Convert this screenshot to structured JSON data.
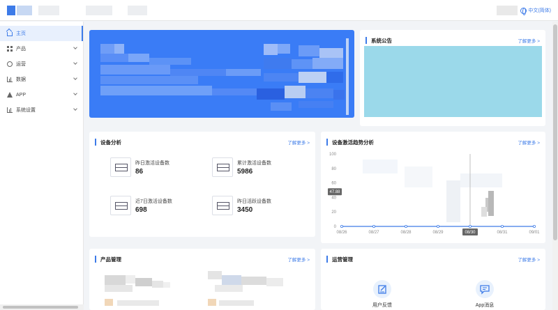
{
  "header": {
    "lang_label": "中文(简体)"
  },
  "sidebar": {
    "items": [
      {
        "label": "主页",
        "icon": "home-icon",
        "active": true,
        "has_children": false
      },
      {
        "label": "产品",
        "icon": "grid-icon",
        "active": false,
        "has_children": true
      },
      {
        "label": "运营",
        "icon": "globe-icon",
        "active": false,
        "has_children": true
      },
      {
        "label": "数据",
        "icon": "bar-chart-icon",
        "active": false,
        "has_children": true
      },
      {
        "label": "APP",
        "icon": "warning-icon",
        "active": false,
        "has_children": true
      },
      {
        "label": "系统设置",
        "icon": "bar-chart-icon",
        "active": false,
        "has_children": true
      }
    ]
  },
  "notice": {
    "title": "系统公告",
    "more": "了解更多 >"
  },
  "device_analysis": {
    "title": "设备分析",
    "more": "了解更多 >",
    "stats": [
      {
        "label": "昨日激活设备数",
        "value": "86"
      },
      {
        "label": "累计激活设备数",
        "value": "5986"
      },
      {
        "label": "近7日激活设备数",
        "value": "698"
      },
      {
        "label": "昨日活跃设备数",
        "value": "3450"
      }
    ]
  },
  "trend": {
    "title": "设备激活趋势分析",
    "more": "了解更多 >",
    "tooltip_value": "47.88",
    "highlight_date": "08/30"
  },
  "product_mgmt": {
    "title": "产品管理",
    "more": "了解更多 >"
  },
  "ops_mgmt": {
    "title": "运营管理",
    "more": "了解更多 >",
    "items": [
      {
        "label": "用户反馈",
        "icon": "feedback-edit-icon"
      },
      {
        "label": "App消息",
        "icon": "message-icon"
      }
    ]
  },
  "chart_data": {
    "type": "line",
    "x": [
      "08/26",
      "08/27",
      "08/28",
      "08/29",
      "08/30",
      "08/31",
      "09/01"
    ],
    "y_ticks": [
      0,
      20,
      40,
      60,
      80,
      100
    ],
    "ylim": [
      0,
      100
    ],
    "series": [
      {
        "values": [
          0,
          0,
          0,
          0,
          0,
          0,
          0
        ]
      }
    ],
    "colors": {
      "line": "#3d7be8"
    }
  }
}
